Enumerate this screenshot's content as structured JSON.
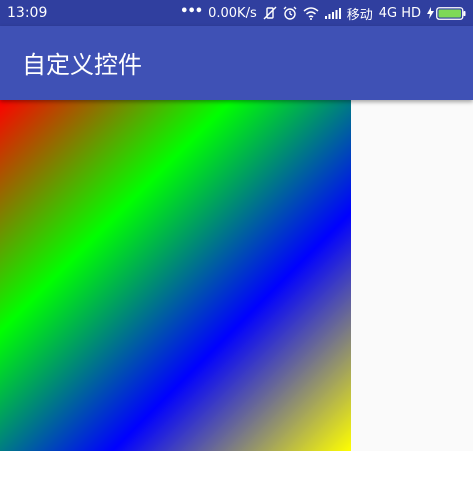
{
  "status_bar": {
    "time": "13:09",
    "net_speed": "0.00K/s",
    "carrier": "移动",
    "network": "4G HD",
    "icons": [
      "more-dots-icon",
      "vibrate-off-icon",
      "alarm-icon",
      "wifi-icon",
      "signal-icon",
      "charging-bolt-icon",
      "battery-icon"
    ],
    "color": "#303f9f"
  },
  "app_bar": {
    "title": "自定义控件",
    "color": "#3f51b5"
  },
  "gradient_view": {
    "direction": "top-left to bottom-right",
    "colors": [
      "#ff0000",
      "#00ff00",
      "#0000ff",
      "#ffff00"
    ]
  },
  "page": {
    "background": "#fafafa"
  }
}
